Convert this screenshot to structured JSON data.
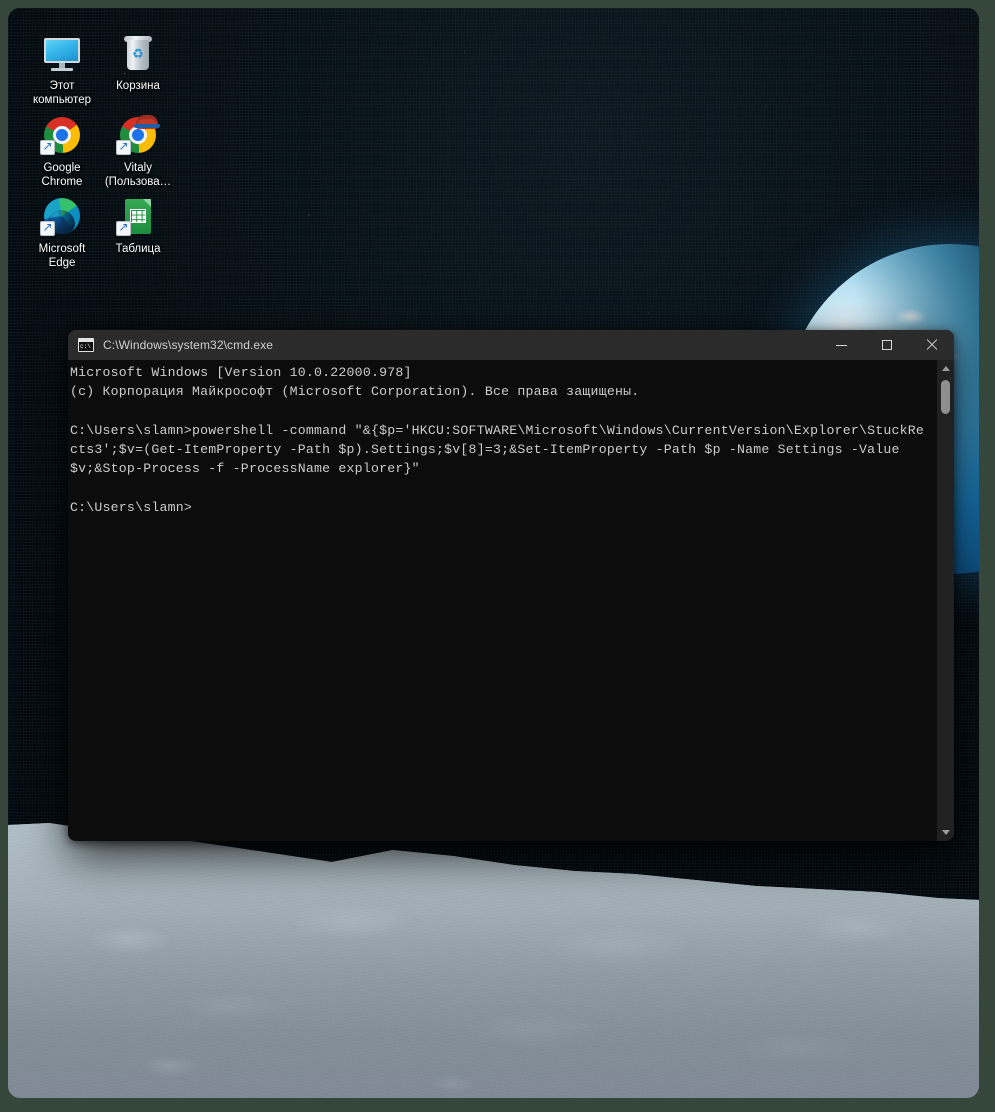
{
  "desktop": {
    "icons": [
      {
        "name": "this-pc",
        "label": "Этот\nкомпьютер",
        "icon": "monitor-icon",
        "shortcut": false
      },
      {
        "name": "recycle-bin",
        "label": "Корзина",
        "icon": "recycle-bin-icon",
        "shortcut": false
      },
      {
        "name": "google-chrome",
        "label": "Google\nChrome",
        "icon": "chrome-icon",
        "shortcut": true
      },
      {
        "name": "vitaly-chrome",
        "label": "Vitaly\n(Пользова…",
        "icon": "chrome-profile-icon",
        "shortcut": true
      },
      {
        "name": "microsoft-edge",
        "label": "Microsoft\nEdge",
        "icon": "edge-icon",
        "shortcut": true
      },
      {
        "name": "google-sheets",
        "label": "Таблица",
        "icon": "sheets-icon",
        "shortcut": true
      }
    ]
  },
  "console_window": {
    "title": "C:\\Windows\\system32\\cmd.exe",
    "app_icon": "cmd-icon",
    "controls": {
      "minimize": "minimize-button",
      "maximize": "maximize-button",
      "close": "close-button"
    },
    "lines": [
      "Microsoft Windows [Version 10.0.22000.978]",
      "(c) Корпорация Майкрософт (Microsoft Corporation). Все права защищены.",
      "",
      "C:\\Users\\slamn>powershell -command \"&{$p='HKCU:SOFTWARE\\Microsoft\\Windows\\CurrentVersion\\Explorer\\StuckRects3';$v=(Get-ItemProperty -Path $p).Settings;$v[8]=3;&Set-ItemProperty -Path $p -Name Settings -Value $v;&Stop-Process -f -ProcessName explorer}\"",
      "",
      "C:\\Users\\slamn>"
    ],
    "scrollbar": {
      "up_arrow": "scroll-up-arrow",
      "down_arrow": "scroll-down-arrow",
      "thumb": "scroll-thumb"
    },
    "colors": {
      "background": "#0c0c0c",
      "text": "#cccccc",
      "titlebar": "#2b2b2b",
      "titlebar_text": "#cfcfcf"
    }
  }
}
